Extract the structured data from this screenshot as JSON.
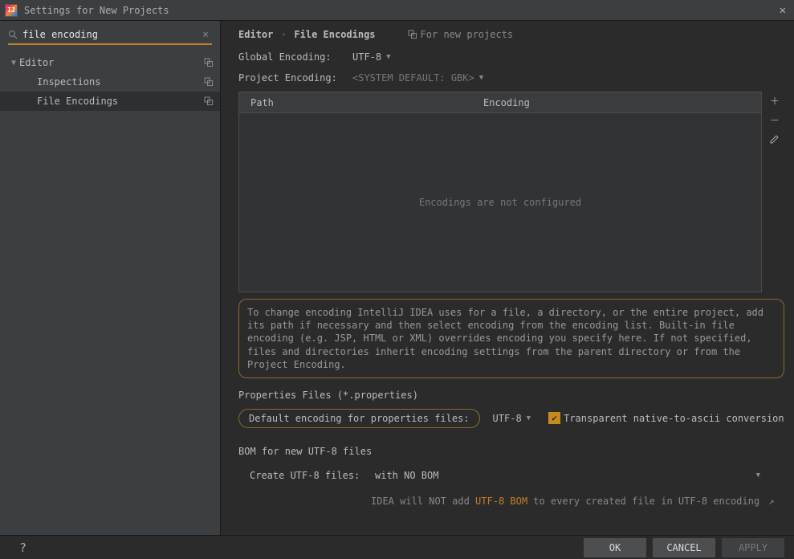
{
  "titlebar": {
    "title": "Settings for New Projects"
  },
  "search": {
    "value": "file encoding"
  },
  "tree": {
    "root": "Editor",
    "items": [
      {
        "label": "Inspections"
      },
      {
        "label": "File Encodings"
      }
    ]
  },
  "breadcrumb": {
    "a": "Editor",
    "b": "File Encodings",
    "note": "For new projects"
  },
  "globalEncoding": {
    "label": "Global Encoding:",
    "value": "UTF-8"
  },
  "projectEncoding": {
    "label": "Project Encoding:",
    "value": "<SYSTEM DEFAULT: GBK>"
  },
  "table": {
    "colPath": "Path",
    "colEnc": "Encoding",
    "empty": "Encodings are not configured"
  },
  "hint": "To change encoding IntelliJ IDEA uses for a file, a directory, or the entire project, add its path if necessary and then select encoding from the encoding list. Built-in file encoding (e.g. JSP, HTML or XML) overrides encoding you specify here. If not specified, files and directories inherit encoding settings from the parent directory or from the Project Encoding.",
  "propsSection": "Properties Files (*.properties)",
  "propsLabel": "Default encoding for properties files:",
  "propsValue": "UTF-8",
  "transparentAscii": "Transparent native-to-ascii conversion",
  "bomSection": "BOM for new UTF-8 files",
  "createUtfLabel": "Create UTF-8 files:",
  "createUtfValue": "with NO BOM",
  "bomNote1": "IDEA will NOT add ",
  "bomNoteHl": "UTF-8 BOM",
  "bomNote2": " to every created file in UTF-8 encoding",
  "buttons": {
    "ok": "OK",
    "cancel": "CANCEL",
    "apply": "APPLY"
  }
}
